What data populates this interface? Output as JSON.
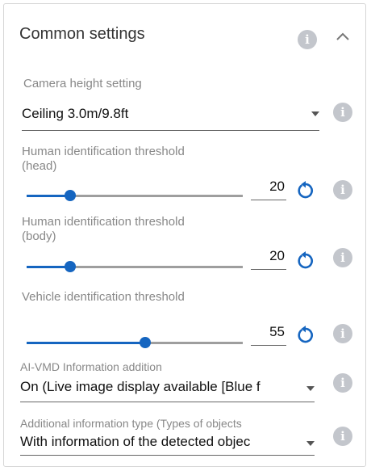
{
  "header": {
    "title": "Common settings"
  },
  "camera_height": {
    "label": "Camera height setting",
    "value": "Ceiling 3.0m/9.8ft"
  },
  "human_head": {
    "label_line1": "Human identification threshold",
    "label_line2": "(head)",
    "value": "20",
    "level": 20
  },
  "human_body": {
    "label_line1": "Human identification threshold",
    "label_line2": "(body)",
    "value": "20",
    "level": 20
  },
  "vehicle": {
    "label": "Vehicle identification threshold",
    "value": "55",
    "level": 55
  },
  "aivmd": {
    "label": "AI-VMD Information addition",
    "value": "On (Live image display available [Blue f"
  },
  "additional_info": {
    "label": "Additional information type (Types of objects",
    "value": "With information of the detected objec"
  },
  "icons": {
    "info": "i",
    "collapse": "chevron-up-icon",
    "reset": "reset-icon",
    "dropdown": "caret-down-icon"
  },
  "colors": {
    "accent": "#1565c0",
    "info": "#c3c6cc",
    "label": "#888888"
  }
}
